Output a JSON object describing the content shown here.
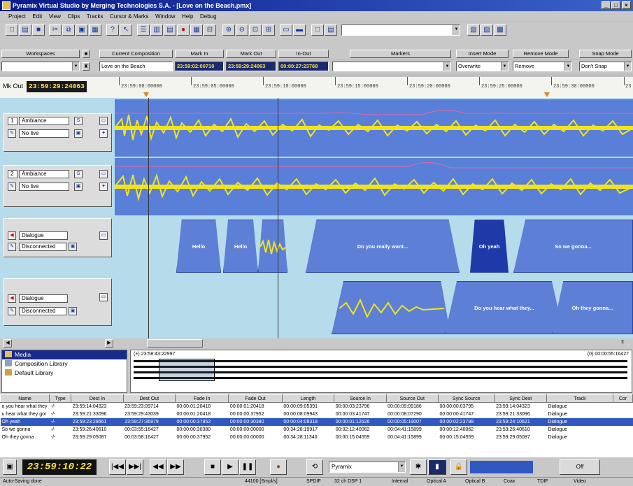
{
  "window": {
    "title": "Pyramix Virtual Studio by Merging Technologies S.A. - [Love on the Beach.pmx]"
  },
  "menu": [
    "Project",
    "Edit",
    "View",
    "Clips",
    "Tracks",
    "Cursor & Marks",
    "Window",
    "Help",
    "Debug"
  ],
  "toolbar": {
    "headers": [
      "Workspaces",
      "Current Composition",
      "Mark In",
      "Mark Out",
      "In-Out",
      "Markers",
      "Insert Mode",
      "Remove Mode",
      "Snap Mode"
    ]
  },
  "values": {
    "composition": "Love on the Beach",
    "mark_in": "23:59:02:00710",
    "mark_out": "23:59:29:24063",
    "in_out": "00:00:27:23768",
    "insert_mode": "Overwrite",
    "remove_mode": "Remove",
    "snap_mode": "Don't Snap"
  },
  "ruler": {
    "mark_out_label": "Mk Out",
    "mark_out_tc": "23:59:29:24063",
    "ticks": [
      "23:59:00:00000",
      "23:59:05:00000",
      "23:59:10:00000",
      "23:59:15:00000",
      "23:59:20:00000",
      "23:59:25:00000",
      "23:59:30:00000",
      "23"
    ]
  },
  "tracks": [
    {
      "num": "1",
      "name": "Ambiance",
      "input": "No live",
      "type": "audio"
    },
    {
      "num": "2",
      "name": "Ambiance",
      "input": "No live",
      "type": "audio"
    },
    {
      "num": "3",
      "name": "Dialogue",
      "input": "Disconnected",
      "type": "dialogue"
    },
    {
      "num": "4",
      "name": "Dialogue",
      "input": "Disconnected",
      "type": "dialogue"
    }
  ],
  "clips_track3": [
    "Hello",
    "Hello",
    "Do you really want...",
    "Oh yeah",
    "So we gonna..."
  ],
  "clips_track4": [
    "Do you hear what they...",
    "Oh they gonna..."
  ],
  "media": {
    "items": [
      "Media",
      "Composition Library",
      "Default Library"
    ],
    "left_tc": "(+) 23:58:43:22997",
    "right_tc": "(0) 00:00:55:16427"
  },
  "cliplist": {
    "headers": [
      "Name",
      "Type",
      "Dest In",
      "Dest Out",
      "Fade In",
      "Fade Out",
      "Length",
      "Source In",
      "Source Out",
      "Sync Source",
      "Sync Dest",
      "Track",
      "Cor"
    ],
    "rows": [
      [
        "o you hear what they",
        "-/-",
        "23:59:14:04323",
        "23:59:23:09714",
        "00:00:01:20418",
        "00:00:01:20418",
        "00:00:09:05391",
        "00:00:03:23796",
        "00:00:09:09186",
        "00:00:00:03795",
        "23:59:14:04323",
        "Dialogue",
        ""
      ],
      [
        "u hear what they gor",
        "-/-",
        "23:59:21:33096",
        "23:59:29:43039",
        "00:00:01:20418",
        "00:00:00:37952",
        "00:00:08:09943",
        "00:00:03:41747",
        "00:00:08:07290",
        "00:00:00:41747",
        "23:59:21:33096",
        "Dialogue",
        ""
      ],
      [
        "Oh yeah",
        "-/-",
        "23:59:23:28661",
        "23:59:27:36979",
        "00:00:00:37952",
        "00:00:00:30380",
        "00:00:04:08318",
        "00:00:01:12626",
        "00:00:05:19007",
        "00:00:02:23798",
        "23:59:24:10621",
        "Dialogue",
        ""
      ],
      [
        "So we gonna",
        "-/-",
        "23:59:26:40610",
        "00:03:55:16427",
        "00:00:00:30380",
        "00:00:00:00000",
        "00:34:28:19917",
        "00:02:12:40062",
        "00:04:41:15899",
        "00:00:12:40062",
        "23:59:26:40610",
        "Dialogue",
        ""
      ],
      [
        "Oh they gonna .",
        "-/-",
        "23:59:29:05087",
        "00:03:58:16427",
        "00:00:00:37952",
        "00:00:00:00000",
        "00:34:28:11340",
        "00:00:15:04559",
        "00:04:41:15899",
        "00:00:15:04559",
        "23:59:29:05087",
        "Dialogue",
        ""
      ]
    ]
  },
  "transport": {
    "timecode": "23:59:10:22",
    "device": "Pyramix",
    "off_label": "Off"
  },
  "status": {
    "left": "Auto-Saving done",
    "items": [
      "44100 [Smpl/s]",
      "SPDIF",
      "32 ch DSP 1",
      "Internal",
      "Optical A",
      "Optical B",
      "Coax",
      "TDIF",
      "Video"
    ]
  },
  "colors": {
    "waveform": "#f2e41c",
    "lane_bg": "#5a7fd8",
    "dialogue_bg": "#b6dcec",
    "clip": "#5d7fd6",
    "timecode_fg": "#ffe040"
  }
}
